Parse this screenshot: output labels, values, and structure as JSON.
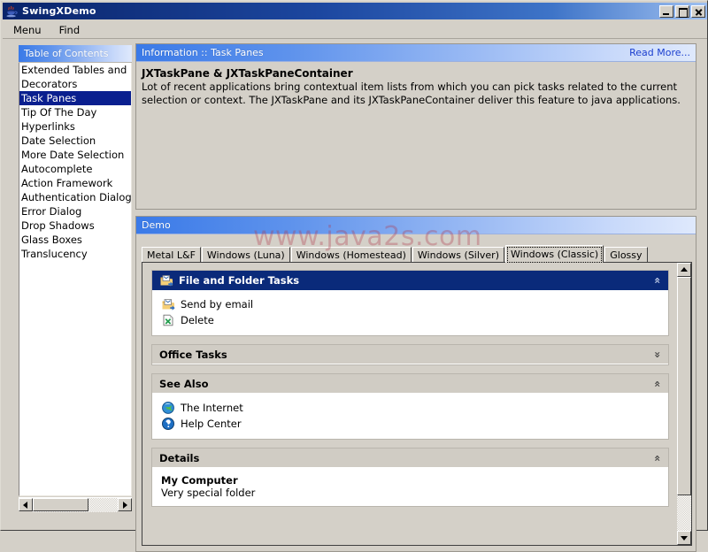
{
  "window": {
    "title": "SwingXDemo",
    "icon": "java-cup-icon",
    "buttons": {
      "minimize": "minimize-button",
      "maximize": "maximize-button",
      "close": "close-button"
    }
  },
  "menubar": {
    "items": [
      "Menu",
      "Find"
    ]
  },
  "toc": {
    "header": "Table of Contents",
    "items": [
      {
        "label": "Extended Tables and",
        "selected": false
      },
      {
        "label": "Decorators",
        "selected": false
      },
      {
        "label": "Task Panes",
        "selected": true
      },
      {
        "label": "Tip Of The Day",
        "selected": false
      },
      {
        "label": "Hyperlinks",
        "selected": false
      },
      {
        "label": "Date Selection",
        "selected": false
      },
      {
        "label": "More Date Selection",
        "selected": false
      },
      {
        "label": "Autocomplete",
        "selected": false
      },
      {
        "label": "Action Framework",
        "selected": false
      },
      {
        "label": "Authentication Dialogs",
        "selected": false
      },
      {
        "label": "Error Dialog",
        "selected": false
      },
      {
        "label": "Drop Shadows",
        "selected": false
      },
      {
        "label": "Glass Boxes",
        "selected": false
      },
      {
        "label": "Translucency",
        "selected": false
      }
    ]
  },
  "info": {
    "header": "Information :: Task Panes",
    "read_more": "Read More...",
    "title": "JXTaskPane & JXTaskPaneContainer",
    "text": "Lot of recent applications bring contextual item lists from which you can pick tasks related to the current selection or context. The JXTaskPane and its JXTaskPaneContainer deliver this feature to java applications."
  },
  "demo": {
    "header": "Demo",
    "tabs": [
      {
        "label": "Metal L&F",
        "selected": false
      },
      {
        "label": "Windows (Luna)",
        "selected": false
      },
      {
        "label": "Windows (Homestead)",
        "selected": false
      },
      {
        "label": "Windows (Silver)",
        "selected": false
      },
      {
        "label": "Windows (Classic)",
        "selected": true
      },
      {
        "label": "Glossy",
        "selected": false
      }
    ],
    "groups": [
      {
        "title": "File and Folder Tasks",
        "style": "special",
        "expanded": true,
        "chevron": "«",
        "icon": "folder-tasks-icon",
        "items": [
          {
            "label": "Send by email",
            "icon": "send-mail-icon"
          },
          {
            "label": "Delete",
            "icon": "delete-icon"
          }
        ]
      },
      {
        "title": "Office Tasks",
        "style": "normal",
        "expanded": false,
        "chevron": "»",
        "items": []
      },
      {
        "title": "See Also",
        "style": "normal",
        "expanded": true,
        "chevron": "«",
        "items": [
          {
            "label": "The Internet",
            "icon": "globe-icon"
          },
          {
            "label": "Help Center",
            "icon": "help-icon"
          }
        ]
      },
      {
        "title": "Details",
        "style": "normal",
        "expanded": true,
        "chevron": "«",
        "detail_title": "My Computer",
        "detail_sub": "Very special folder",
        "items": []
      }
    ]
  },
  "watermark": {
    "text": "www.java2s.com"
  },
  "colors": {
    "titlebar_start": "#0a246a",
    "header_gradient_start": "#3a7ae8",
    "selection": "#0a1f8f",
    "face": "#d4d0c8",
    "link": "#1b3fcf",
    "special_header": "#0a2a7a"
  }
}
